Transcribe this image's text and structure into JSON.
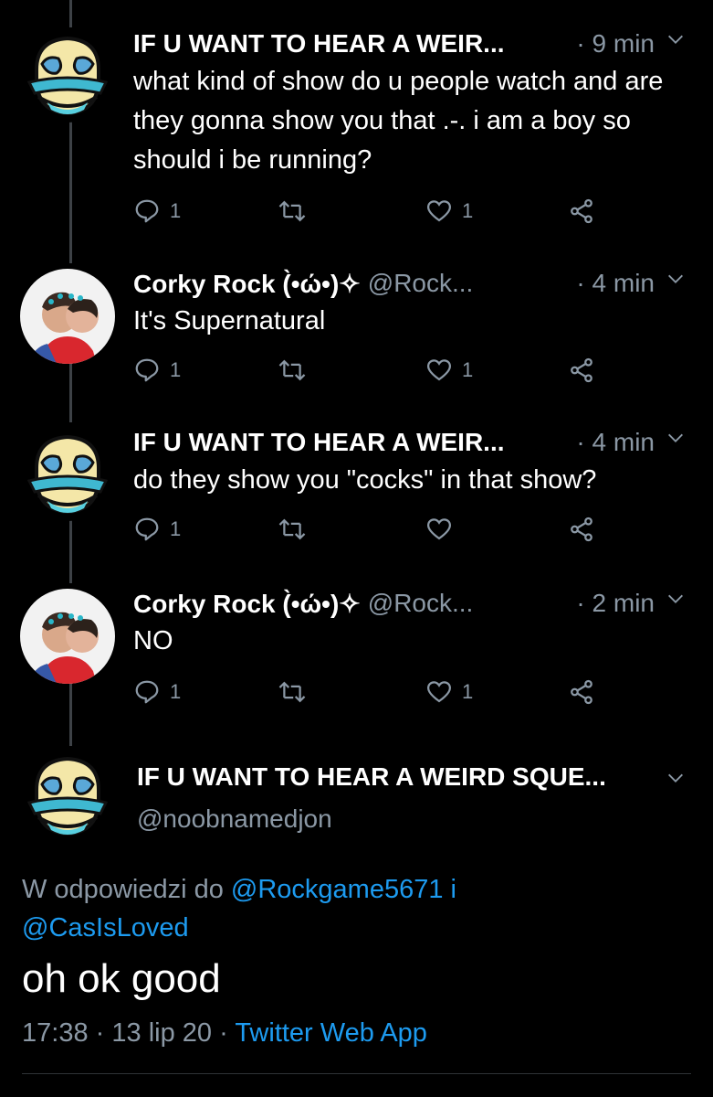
{
  "colors": {
    "background": "#000000",
    "text": "#ffffff",
    "muted": "#8b98a5",
    "link": "#1d9bf0",
    "thread_line": "#3d4146"
  },
  "tweets": [
    {
      "name": "IF U WANT TO HEAR A WEIR...",
      "handle": "",
      "time": "· 9 min",
      "text": "what kind of show do u people watch and are they gonna show you that .-. i am a boy so should i be running?",
      "reply_count": "1",
      "retweet_count": "",
      "like_count": "1",
      "avatar": "face-avatar"
    },
    {
      "name": "Corky Rock (̀•ώ•)✧",
      "handle": "@Rock...",
      "time": "· 4 min",
      "text": "It's Supernatural",
      "reply_count": "1",
      "retweet_count": "",
      "like_count": "1",
      "avatar": "photo-avatar"
    },
    {
      "name": "IF U WANT TO HEAR A WEIR...",
      "handle": "",
      "time": "· 4 min",
      "text": "do they show you \"cocks\" in that show?",
      "reply_count": "1",
      "retweet_count": "",
      "like_count": "",
      "avatar": "face-avatar"
    },
    {
      "name": "Corky Rock (̀•ώ•)✧",
      "handle": "@Rock...",
      "time": "· 2 min",
      "text": "NO",
      "reply_count": "1",
      "retweet_count": "",
      "like_count": "1",
      "avatar": "photo-avatar"
    }
  ],
  "focused": {
    "name": "IF U WANT TO HEAR A WEIRD SQUE...",
    "handle": "@noobnamedjon",
    "reply_prefix": "W odpowiedzi do",
    "reply_user1": "@Rockgame5671",
    "reply_and": "i",
    "reply_user2": "@CasIsLoved",
    "text": "oh ok good",
    "time": "17:38",
    "date": "13 lip 20",
    "source": "Twitter Web App",
    "sep": "·"
  }
}
